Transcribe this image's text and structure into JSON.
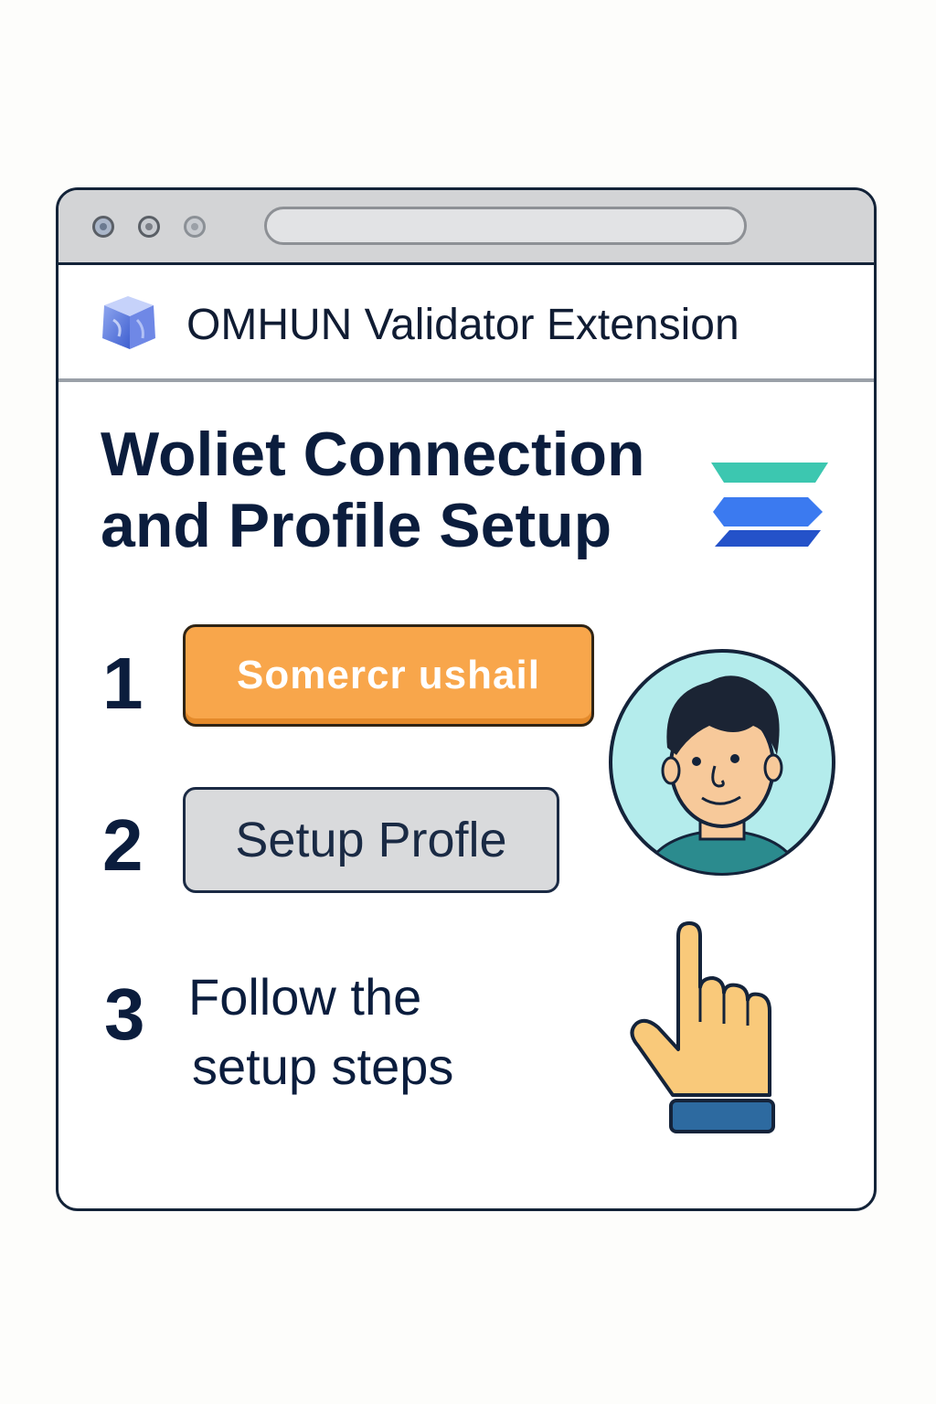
{
  "window": {
    "address_bar": ""
  },
  "extension": {
    "title": "OMHUN Validator Extension",
    "logo_icon": "cube-logo-icon"
  },
  "heading": {
    "line1": "Woliet Connection",
    "line2": "and Profile Setup",
    "icon": "layer-stack-icon"
  },
  "steps": [
    {
      "number": "1",
      "button_label": "Somercr ushail"
    },
    {
      "number": "2",
      "button_label": "Setup Profle"
    },
    {
      "number": "3",
      "text_line1": "Follow the",
      "text_line2": "setup steps"
    }
  ],
  "illustrations": {
    "avatar": "user-avatar-icon",
    "pointer": "pointing-hand-icon"
  },
  "colors": {
    "connect_button": "#f8a64b",
    "setup_button": "#d9dadc",
    "heading_text": "#0b1d3d",
    "avatar_bg": "#b4ecec",
    "stack_teal": "#3cc7b0",
    "stack_blue": "#2f6ee0"
  }
}
